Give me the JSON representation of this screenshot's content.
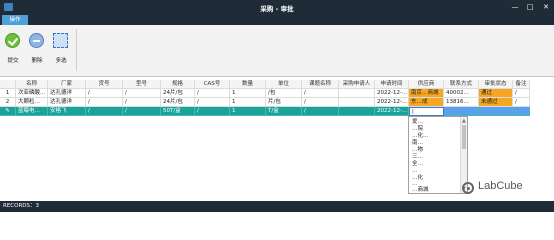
{
  "window": {
    "title": "采购 - 审批",
    "min_glyph": "—",
    "max_glyph": "□",
    "close_glyph": "✕"
  },
  "tabs": [
    {
      "label": "操作"
    }
  ],
  "toolbar": {
    "submit_label": "提交",
    "delete_label": "删除",
    "multi_label": "多选"
  },
  "table": {
    "headers": [
      "名称",
      "厂家",
      "货号",
      "型号",
      "规格",
      "CAS号",
      "数量",
      "单位",
      "课题名称",
      "采购申请人",
      "申请时间",
      "供应商",
      "联系方式",
      "审批状态",
      "备注"
    ],
    "rows": [
      {
        "num": "1",
        "cells": [
          "次亚磷酸…",
          "达孔德洋",
          "/",
          "/",
          "24片/包",
          "/",
          "1",
          "/包",
          "/",
          "",
          "2022-12-…",
          "南京…商城",
          "40002…",
          "通过",
          "/"
        ]
      },
      {
        "num": "2",
        "cells": [
          "大颗粒…",
          "达孔德洋",
          "/",
          "/",
          "24片/包",
          "/",
          "1",
          "片/包",
          "/",
          "",
          "2022-12-…",
          "东…成",
          "13816…",
          "未通过",
          "/"
        ]
      },
      {
        "num": "✎",
        "cells": [
          "蓝莓电…",
          "安格飞",
          "/",
          "/",
          "50T/盒",
          "/",
          "1",
          "T/盒",
          "/",
          "",
          "2022-12-…",
          "|",
          "",
          "",
          ""
        ]
      }
    ]
  },
  "supplier_dropdown": {
    "options": [
      "爱…",
      "…院",
      "…化…",
      "南…",
      "…物",
      "三…",
      "全…",
      "…",
      "…化",
      "…",
      "…商城"
    ]
  },
  "watermark": {
    "text": "LabCube"
  },
  "status": {
    "records_text": "RECORDS：3"
  }
}
